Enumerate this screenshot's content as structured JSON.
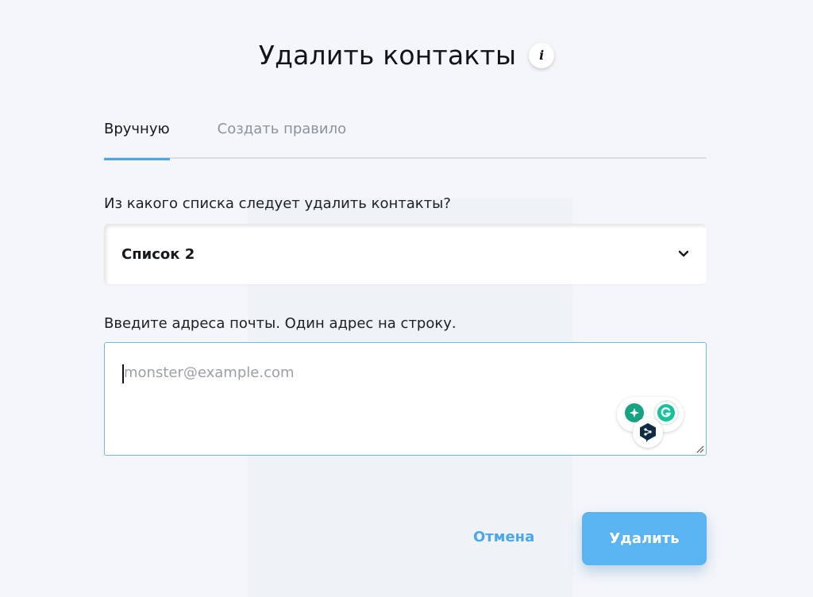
{
  "dialog": {
    "title": "Удалить контакты"
  },
  "tabs": [
    {
      "label": "Вручную",
      "active": true
    },
    {
      "label": "Создать правило",
      "active": false
    }
  ],
  "list_question": "Из какого списка следует удалить контакты?",
  "list_select": {
    "value": "Список 2"
  },
  "emails_label": "Введите адреса почты. Один адрес на строку.",
  "emails_input": {
    "value": "",
    "placeholder": "monster@example.com"
  },
  "actions": {
    "cancel_label": "Отмена",
    "delete_label": "Удалить"
  },
  "colors": {
    "accent": "#4aa7ea",
    "button": "#5ab4f2",
    "background": "#f4f6fa"
  },
  "icons": [
    "info-icon",
    "chevron-down-icon",
    "resize-handle-icon",
    "grammar-assistant-icon",
    "grammarly-icon",
    "deepl-icon"
  ]
}
